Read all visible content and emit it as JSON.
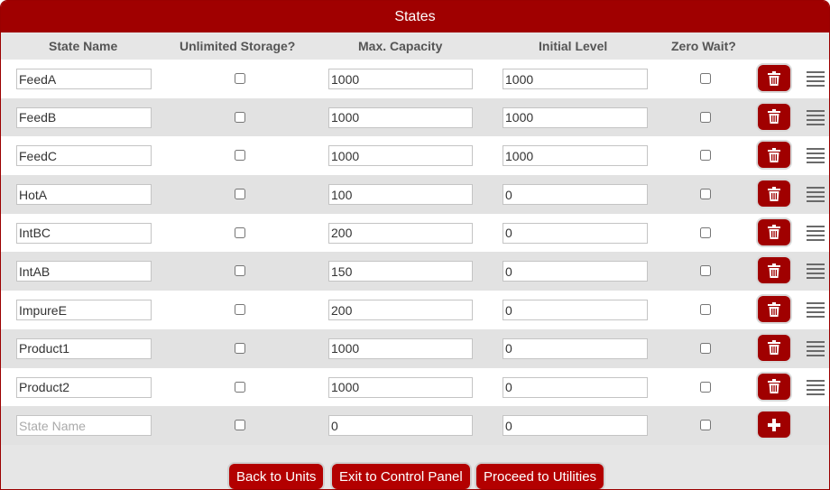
{
  "title": "States",
  "headers": {
    "state_name": "State Name",
    "unlimited_storage": "Unlimited Storage?",
    "max_capacity": "Max. Capacity",
    "initial_level": "Initial Level",
    "zero_wait": "Zero Wait?"
  },
  "rows": [
    {
      "name": "FeedA",
      "unlimited": false,
      "capacity": "1000",
      "initial": "1000",
      "zero_wait": false
    },
    {
      "name": "FeedB",
      "unlimited": false,
      "capacity": "1000",
      "initial": "1000",
      "zero_wait": false
    },
    {
      "name": "FeedC",
      "unlimited": false,
      "capacity": "1000",
      "initial": "1000",
      "zero_wait": false
    },
    {
      "name": "HotA",
      "unlimited": false,
      "capacity": "100",
      "initial": "0",
      "zero_wait": false
    },
    {
      "name": "IntBC",
      "unlimited": false,
      "capacity": "200",
      "initial": "0",
      "zero_wait": false
    },
    {
      "name": "IntAB",
      "unlimited": false,
      "capacity": "150",
      "initial": "0",
      "zero_wait": false
    },
    {
      "name": "ImpureE",
      "unlimited": false,
      "capacity": "200",
      "initial": "0",
      "zero_wait": false
    },
    {
      "name": "Product1",
      "unlimited": false,
      "capacity": "1000",
      "initial": "0",
      "zero_wait": false
    },
    {
      "name": "Product2",
      "unlimited": false,
      "capacity": "1000",
      "initial": "0",
      "zero_wait": false
    }
  ],
  "new_row": {
    "name_placeholder": "State Name",
    "capacity": "0",
    "initial": "0"
  },
  "icons": {
    "delete": "trash-icon",
    "add": "plus-icon",
    "drag": "drag-handle-icon"
  },
  "footer": {
    "back_label": "Back to Units",
    "exit_label": "Exit to Control Panel",
    "proceed_label": "Proceed to Utilities"
  },
  "colors": {
    "accent": "#a00000",
    "header_bg": "#e6e6e6",
    "row_alt": "#e2e2e2"
  }
}
